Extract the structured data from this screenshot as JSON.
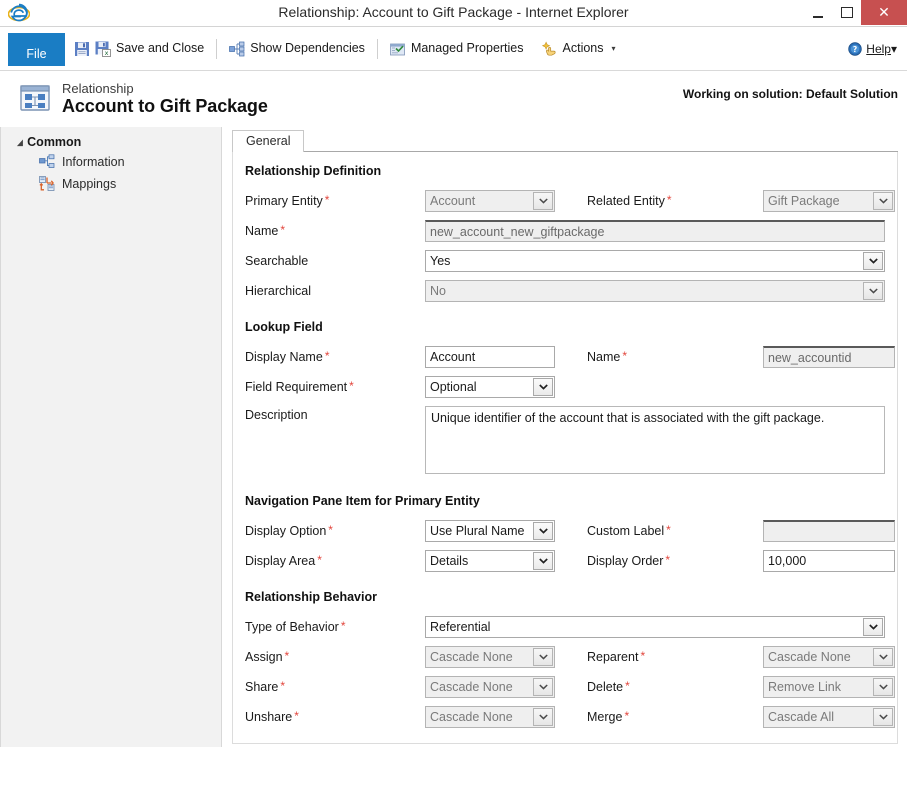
{
  "window": {
    "title": "Relationship: Account to Gift Package - Internet Explorer",
    "logo_icon": "internet-explorer-icon",
    "minimize_label": "",
    "maximize_label": "",
    "close_label": "✕"
  },
  "ribbon": {
    "file_tab": "File",
    "commands": [
      {
        "label": "Save and Close",
        "icon": "save-and-close-icon"
      },
      {
        "label": "Show Dependencies",
        "icon": "dependencies-icon"
      },
      {
        "label": "Managed Properties",
        "icon": "managed-properties-icon"
      },
      {
        "label": "Actions",
        "icon": "actions-icon",
        "caret": "▾"
      }
    ],
    "help": {
      "label": "Help",
      "icon": "help-icon",
      "caret": "▾"
    }
  },
  "header": {
    "subtitle": "Relationship",
    "title": "Account to Gift Package",
    "entity_icon": "relationship-entity-icon",
    "solution_note": "Working on solution: Default Solution"
  },
  "sidebar": {
    "group_label": "Common",
    "group_caret": "◢",
    "items": [
      {
        "label": "Information",
        "icon": "information-icon"
      },
      {
        "label": "Mappings",
        "icon": "mappings-icon"
      }
    ]
  },
  "tabs": [
    {
      "label": "General",
      "selected": true
    }
  ],
  "form": {
    "sections": [
      {
        "title": "Relationship Definition",
        "fields": {
          "primary_entity_label": "Primary Entity",
          "primary_entity_value": "Account",
          "related_entity_label": "Related Entity",
          "related_entity_value": "Gift Package",
          "name_label": "Name",
          "name_value": "new_account_new_giftpackage",
          "searchable_label": "Searchable",
          "searchable_value": "Yes",
          "hierarchical_label": "Hierarchical",
          "hierarchical_value": "No"
        }
      },
      {
        "title": "Lookup Field",
        "fields": {
          "display_name_label": "Display Name",
          "display_name_value": "Account",
          "name_label": "Name",
          "name_value": "new_accountid",
          "field_requirement_label": "Field Requirement",
          "field_requirement_value": "Optional",
          "description_label": "Description",
          "description_value": "Unique identifier of the account that is associated with the gift package."
        }
      },
      {
        "title": "Navigation Pane Item for Primary Entity",
        "fields": {
          "display_option_label": "Display Option",
          "display_option_value": "Use Plural Name",
          "custom_label_label": "Custom Label",
          "custom_label_value": "",
          "display_area_label": "Display Area",
          "display_area_value": "Details",
          "display_order_label": "Display Order",
          "display_order_value": "10,000"
        }
      },
      {
        "title": "Relationship Behavior",
        "fields": {
          "type_of_behavior_label": "Type of Behavior",
          "type_of_behavior_value": "Referential",
          "assign_label": "Assign",
          "assign_value": "Cascade None",
          "reparent_label": "Reparent",
          "reparent_value": "Cascade None",
          "share_label": "Share",
          "share_value": "Cascade None",
          "delete_label": "Delete",
          "delete_value": "Remove Link",
          "unshare_label": "Unshare",
          "unshare_value": "Cascade None",
          "merge_label": "Merge",
          "merge_value": "Cascade All"
        }
      }
    ],
    "required_marker": "*"
  },
  "colors": {
    "file_tab_blue": "#1a7dc4",
    "close_red": "#c75050",
    "required_red": "#e2453c",
    "sidebar_bg": "#f2f2f2"
  }
}
